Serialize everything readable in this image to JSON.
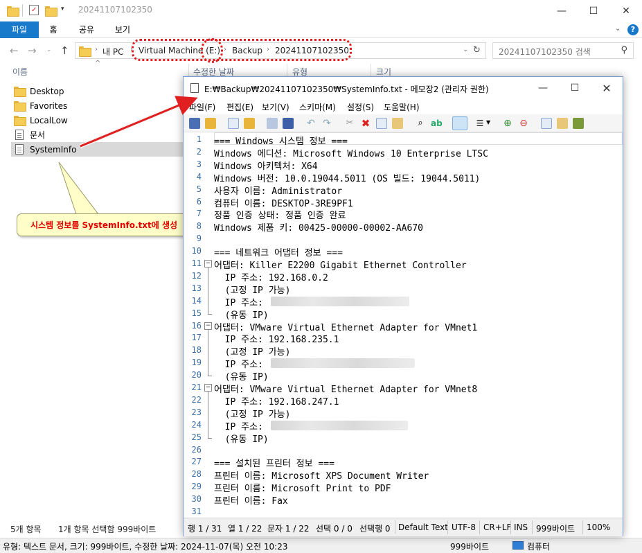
{
  "explorer": {
    "title": "20241107102350",
    "ribbon_tabs": [
      "파일",
      "홈",
      "공유",
      "보기"
    ],
    "breadcrumbs": [
      "내 PC",
      "Virtual Machine (E:)",
      "Backup",
      "20241107102350"
    ],
    "search_placeholder": "20241107102350 검색",
    "column_headers": [
      "이름",
      "수정한 날짜",
      "유형",
      "크기"
    ],
    "nav_items": [
      "Desktop",
      "Favorites",
      "LocalLow",
      "문서",
      "SystemInfo"
    ],
    "status_items": "5개 항목",
    "status_selected": "1개 항목 선택함 999바이트",
    "bottom_info": "유형: 텍스트 문서, 크기: 999바이트, 수정한 날짜: 2024-11-07(목) 오전 10:23",
    "bottom_size": "999바이트",
    "bottom_computer": "컴퓨터"
  },
  "callout": {
    "text": "시스템 정보를 SystemInfo.txt에  생성"
  },
  "notepad": {
    "title": "E:₩Backup₩20241107102350₩SystemInfo.txt - 메모장2 (관리자 권한)",
    "menu": [
      "파일(F)",
      "편집(E)",
      "보기(V)",
      "스키마(M)",
      "설정(S)",
      "도움말(H)"
    ],
    "lines": [
      "=== Windows 시스템 정보 ===",
      "Windows 에디션: Microsoft Windows 10 Enterprise LTSC",
      "Windows 아키텍처: X64",
      "Windows 버전: 10.0.19044.5011 (OS 빌드: 19044.5011)",
      "사용자 이름: Administrator",
      "컴퓨터 이름: DESKTOP-3RE9PF1",
      "정품 인증 상태: 정품 인증 완료",
      "Windows 제품 키: 00425-00000-00002-AA670",
      "",
      "=== 네트워크 어댑터 정보 ===",
      "어댑터: Killer E2200 Gigabit Ethernet Controller",
      "  IP 주소: 192.168.0.2",
      "  (고정 IP 가능)",
      "  IP 주소: ",
      "  (유동 IP)",
      "어댑터: VMware Virtual Ethernet Adapter for VMnet1",
      "  IP 주소: 192.168.235.1",
      "  (고정 IP 가능)",
      "  IP 주소: ",
      "  (유동 IP)",
      "어댑터: VMware Virtual Ethernet Adapter for VMnet8",
      "  IP 주소: 192.168.247.1",
      "  (고정 IP 가능)",
      "  IP 주소: ",
      "  (유동 IP)",
      "",
      "=== 설치된 프린터 정보 ===",
      "프린터 이름: Microsoft XPS Document Writer",
      "프린터 이름: Microsoft Print to PDF",
      "프린터 이름: Fax",
      ""
    ],
    "status": {
      "line": "행 1 / 31",
      "col": "열 1 / 22",
      "char": "문자 1 / 22",
      "sel": "선택 0 / 0",
      "selline": "선택행 0",
      "scheme": "Default Text",
      "encoding": "UTF-8",
      "eol": "CR+LF",
      "ins": "INS",
      "size": "999바이트",
      "zoom": "100%"
    }
  },
  "colors": {
    "accent": "#1979ca",
    "highlight": "#e02020",
    "callout_bg": "#fffec8"
  }
}
